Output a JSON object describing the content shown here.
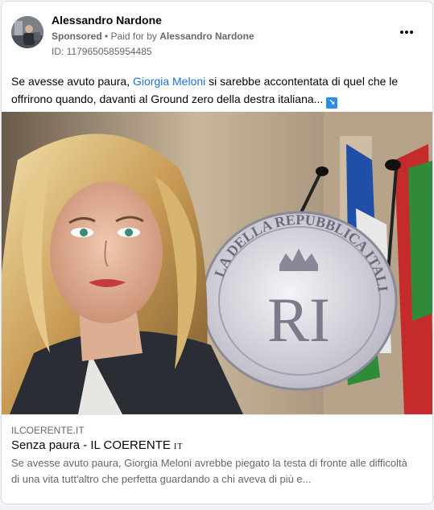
{
  "post": {
    "author": "Alessandro Nardone",
    "sponsored_label": "Sponsored",
    "paid_for_prefix": "• Paid for by",
    "paid_for_name": "Alessandro Nardone",
    "ad_id": "ID: 1179650585954485",
    "text_before": "Se avesse avuto paura, ",
    "mention": "Giorgia Meloni",
    "text_after": " si sarebbe accontentata di quel che le offrirono quando, davanti al Ground zero della destra italiana...",
    "emoji_icon": "arrow-down-right-emoji-icon"
  },
  "media": {
    "seal_text": "LA DELLA REPUBBLICA ITALIANA",
    "monogram": "RI"
  },
  "link": {
    "domain": "ILCOERENTE.IT",
    "title_main": "Senza paura - IL COERENTE ",
    "title_suffix": "IT",
    "description": "Se avesse avuto paura, Giorgia Meloni avrebbe piegato la testa di fronte alle difficoltà di una vita tutt'altro che perfetta guardando a chi aveva di più e..."
  },
  "colors": {
    "accent": "#216fdb",
    "secondary_text": "#65676b",
    "background": "#f0f2f5"
  }
}
